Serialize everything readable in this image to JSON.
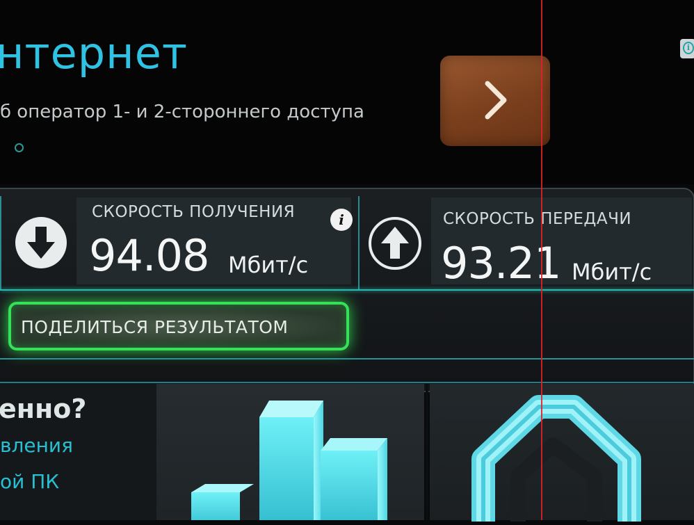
{
  "ad": {
    "title": "нтернет",
    "subtitle": "б оператор 1- и 2-стороннего доступа",
    "next_icon": "chevron-right-icon",
    "info_icon": "info-icon",
    "info_glyph": "i"
  },
  "result": {
    "download": {
      "label": "СКОРОСТЬ ПОЛУЧЕНИЯ",
      "value": "94.08",
      "unit": "Мбит/с",
      "icon": "arrow-down-icon"
    },
    "upload": {
      "label": "СКОРОСТЬ ПЕРЕДАЧИ",
      "value": "93.21",
      "unit": "Мбит/с",
      "icon": "arrow-up-icon"
    },
    "info_glyph": "i",
    "share_label": "ПОДЕЛИТЬСЯ РЕЗУЛЬТАТОМ"
  },
  "promo": {
    "heading": "енно?",
    "line1": "вления",
    "line2": "ой ПК"
  },
  "colors": {
    "accent_cyan": "#2fc2e3",
    "share_green": "#37e05a",
    "ad_button_brown": "#7a3f1d",
    "overlay_red_line": "#e0202a"
  }
}
